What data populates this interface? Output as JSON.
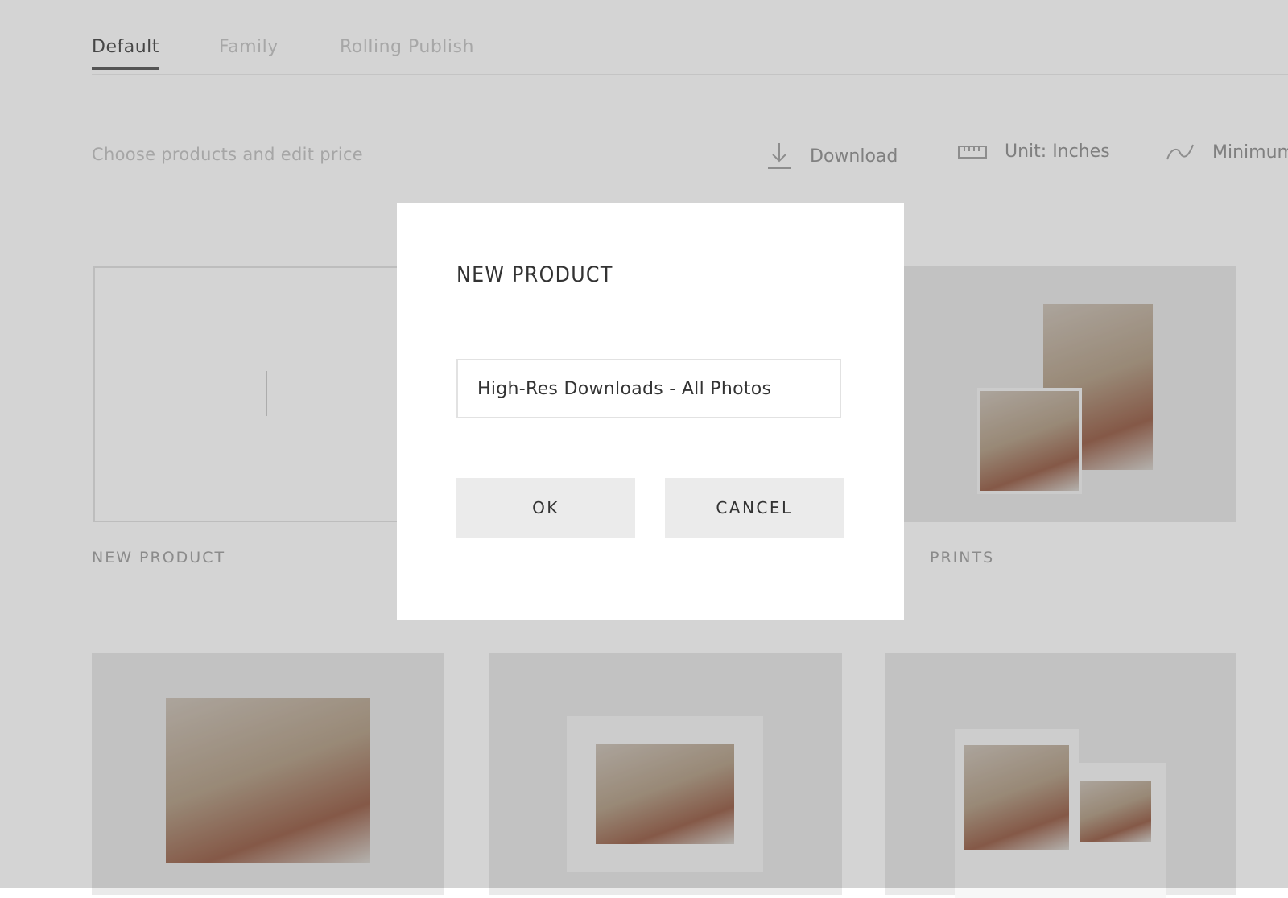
{
  "tabs": [
    {
      "label": "Default",
      "active": true
    },
    {
      "label": "Family",
      "active": false
    },
    {
      "label": "Rolling Publish",
      "active": false
    }
  ],
  "toolbar": {
    "subtitle": "Choose products and edit price",
    "download_label": "Download",
    "unit_label": "Unit: Inches",
    "minimum_label": "Minimum"
  },
  "products": {
    "new_product_label": "NEW PRODUCT",
    "prints_label": "PRINTS"
  },
  "modal": {
    "title": "NEW PRODUCT",
    "input_value": "High-Res Downloads - All Photos",
    "ok_label": "OK",
    "cancel_label": "CANCEL"
  },
  "icons": [
    "download-icon",
    "ruler-icon",
    "minimum-icon",
    "plus-icon"
  ]
}
